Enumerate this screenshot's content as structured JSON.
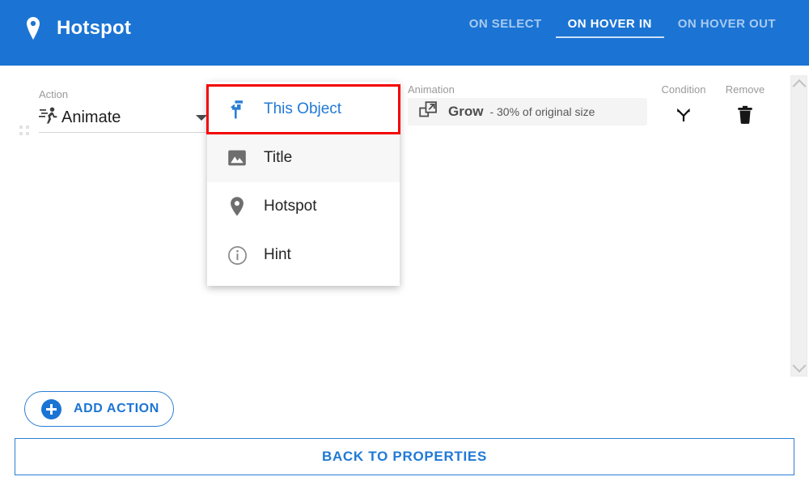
{
  "header": {
    "icon": "map-pin-icon",
    "title": "Hotspot",
    "tabs": [
      {
        "label": "ON SELECT",
        "active": false
      },
      {
        "label": "ON HOVER IN",
        "active": true
      },
      {
        "label": "ON HOVER OUT",
        "active": false
      }
    ]
  },
  "action_row": {
    "drag_handle_icon": "drag-handle-icon",
    "action": {
      "label": "Action",
      "icon": "running-person-icon",
      "value": "Animate",
      "caret_icon": "chevron-down-icon"
    },
    "animation": {
      "label": "Animation",
      "icon": "grow-expand-icon",
      "name": "Grow",
      "detail": "- 30% of original size"
    },
    "condition": {
      "label": "Condition",
      "icon": "branch-fork-icon"
    },
    "remove": {
      "label": "Remove",
      "icon": "trash-icon"
    }
  },
  "scrollbar": {
    "up_icon": "chevron-up-icon",
    "down_icon": "chevron-down-icon"
  },
  "dropdown": {
    "items": [
      {
        "label": "This Object",
        "icon": "object-pin-icon",
        "selected": true,
        "alt": false
      },
      {
        "label": "Title",
        "icon": "image-icon",
        "selected": false,
        "alt": true
      },
      {
        "label": "Hotspot",
        "icon": "map-pin-icon",
        "selected": false,
        "alt": false
      },
      {
        "label": "Hint",
        "icon": "info-circle-icon",
        "selected": false,
        "alt": false
      }
    ]
  },
  "footer": {
    "add_action_label": "ADD ACTION",
    "add_action_icon": "plus-circle-icon",
    "back_label": "BACK TO PROPERTIES"
  },
  "colors": {
    "header_blue": "#1b74d4",
    "link_blue": "#2079d6",
    "highlight_red": "#f30505",
    "chip_gray": "#f4f4f4",
    "label_gray": "#9a9a9a"
  }
}
